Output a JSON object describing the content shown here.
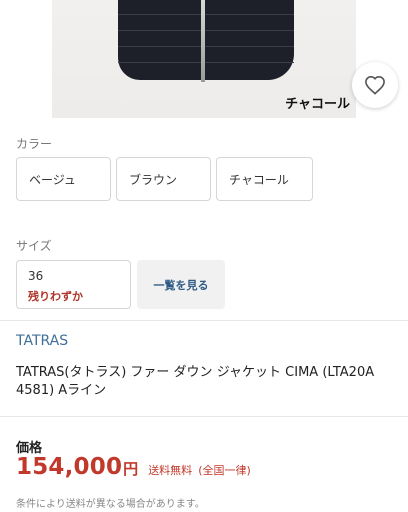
{
  "product_image": {
    "caption": "チャコール",
    "icon": "jacket-image"
  },
  "favorite": {
    "icon": "heart-icon"
  },
  "color_section": {
    "label": "カラー",
    "options": [
      "ベージュ",
      "ブラウン",
      "チャコール"
    ]
  },
  "size_section": {
    "label": "サイズ",
    "option": {
      "value": "36",
      "stock": "残りわずか"
    },
    "list_button": "一覧を見る"
  },
  "product": {
    "brand": "TATRAS",
    "title": "TATRAS(タトラス) ファー ダウン ジャケット CIMA (LTA20A 4581) Aライン"
  },
  "price": {
    "label": "価格",
    "amount": "154,000",
    "currency": "円",
    "shipping": "送料無料",
    "region": "(全国一律)",
    "note": "条件により送料が異なる場合があります。"
  },
  "colors": {
    "accent": "#c0392b",
    "link": "#3f6f98",
    "border": "#d6d6d6"
  }
}
